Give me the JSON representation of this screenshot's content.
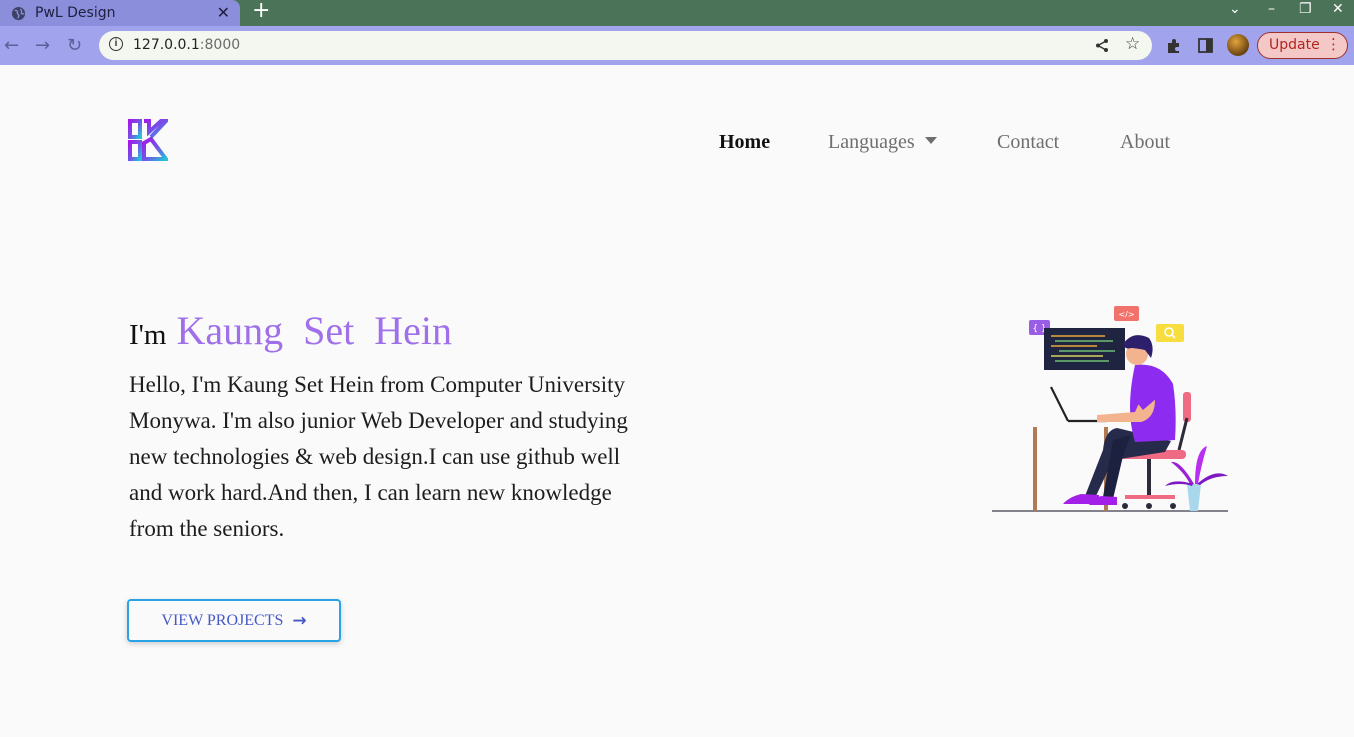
{
  "browser": {
    "tab_title": "PwL Design",
    "tab_close": "✕",
    "new_tab": "+",
    "url_host": "127.0.0.1",
    "url_port": ":8000",
    "update_label": "Update",
    "window_controls": [
      "⌄",
      "–",
      "❐",
      "✕"
    ]
  },
  "site": {
    "nav": [
      {
        "label": "Home",
        "active": true
      },
      {
        "label": "Languages",
        "dropdown": true
      },
      {
        "label": "Contact"
      },
      {
        "label": "About"
      }
    ],
    "hero": {
      "prefix": "I'm",
      "name": "Kaung Set Hein",
      "bio": "Hello, I'm Kaung Set Hein from Computer University Monywa. I'm also junior Web Developer and studying new technologies & web design.I can use github well and work hard.And then, I can learn new knowledge from the seniors.",
      "cta_label": "VIEW PROJECTS"
    }
  },
  "colors": {
    "accent": "#9f70ea",
    "button_border": "#29a3e6",
    "button_text": "#4658c7",
    "tab_active": "#8b8fdb",
    "toolbar": "#a1a4ec",
    "tabbar": "#4a7357"
  }
}
